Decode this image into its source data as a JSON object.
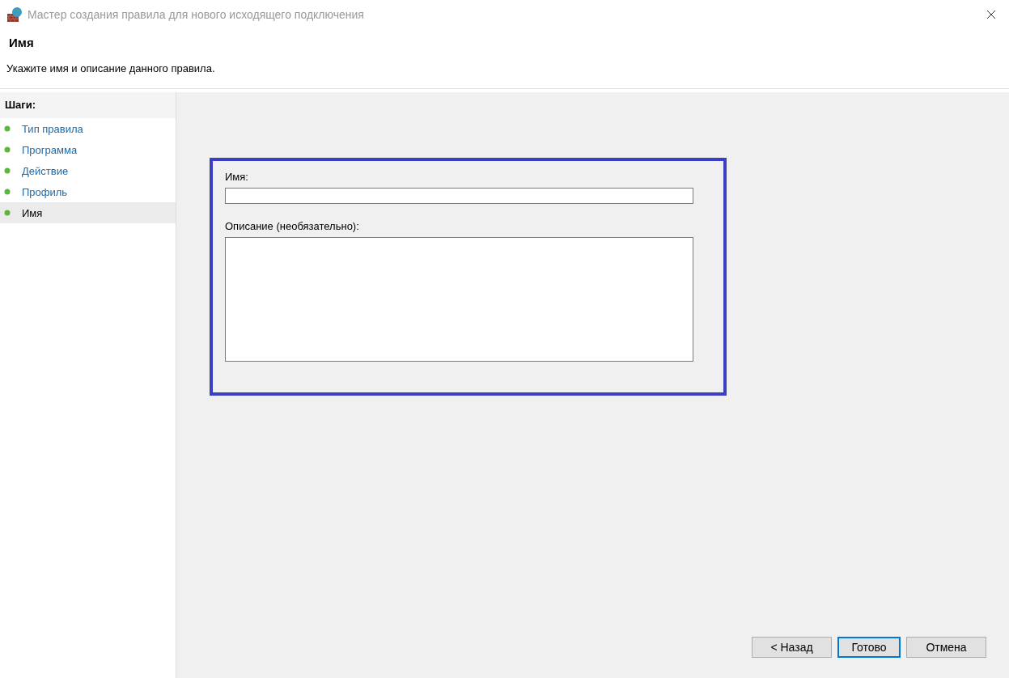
{
  "window": {
    "title": "Мастер создания правила для нового исходящего подключения"
  },
  "header": {
    "title": "Имя",
    "description": "Укажите имя и описание данного правила."
  },
  "steps": {
    "heading": "Шаги:",
    "items": [
      {
        "label": "Тип правила",
        "selected": false
      },
      {
        "label": "Программа",
        "selected": false
      },
      {
        "label": "Действие",
        "selected": false
      },
      {
        "label": "Профиль",
        "selected": false
      },
      {
        "label": "Имя",
        "selected": true
      }
    ]
  },
  "form": {
    "name_label": "Имя:",
    "description_label": "Описание (необязательно):"
  },
  "buttons": [
    {
      "label": "< Назад",
      "default": false
    },
    {
      "label": "Готово",
      "default": true
    },
    {
      "label": "Отмена",
      "default": false
    }
  ]
}
